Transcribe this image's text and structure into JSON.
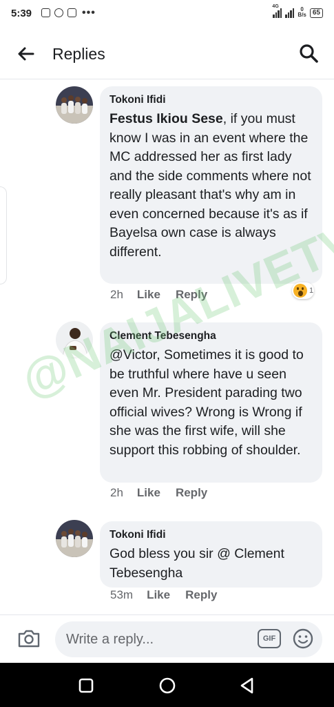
{
  "status_bar": {
    "time": "5:39",
    "network_type": "4G",
    "net_speed_value": "0",
    "net_speed_unit": "B/s",
    "battery": "65"
  },
  "header": {
    "title": "Replies"
  },
  "comments": [
    {
      "author": "Tokoni Ifidi",
      "mention": "Festus Ikiou Sese",
      "text": ", if you must know I was in an event where the MC addressed her as first lady and the side comments where not really pleasant that's why am in even concerned because it's as if Bayelsa own case is always different.",
      "time": "2h",
      "like_label": "Like",
      "reply_label": "Reply",
      "reaction_icon": "wow-reaction-icon",
      "reaction_count": "1"
    },
    {
      "author": "Clement Tebesengha",
      "text": "@Victor, Sometimes it is good to be truthful where have u seen even Mr. President parading two official wives? Wrong is Wrong if she was the first wife, will she support this robbing of shoulder.",
      "time": "2h",
      "like_label": "Like",
      "reply_label": "Reply"
    },
    {
      "author": "Tokoni Ifidi",
      "text": "God bless you sir @ Clement Tebesengha",
      "time": "53m",
      "like_label": "Like",
      "reply_label": "Reply"
    }
  ],
  "watermark": "@NAIJALIVETV",
  "reply_bar": {
    "placeholder": "Write a reply...",
    "gif_label": "GIF"
  },
  "colors": {
    "bubble": "#f0f2f5",
    "meta_text": "#65676b",
    "watermark": "#6ec878",
    "wow_reaction": "#f7b125"
  }
}
